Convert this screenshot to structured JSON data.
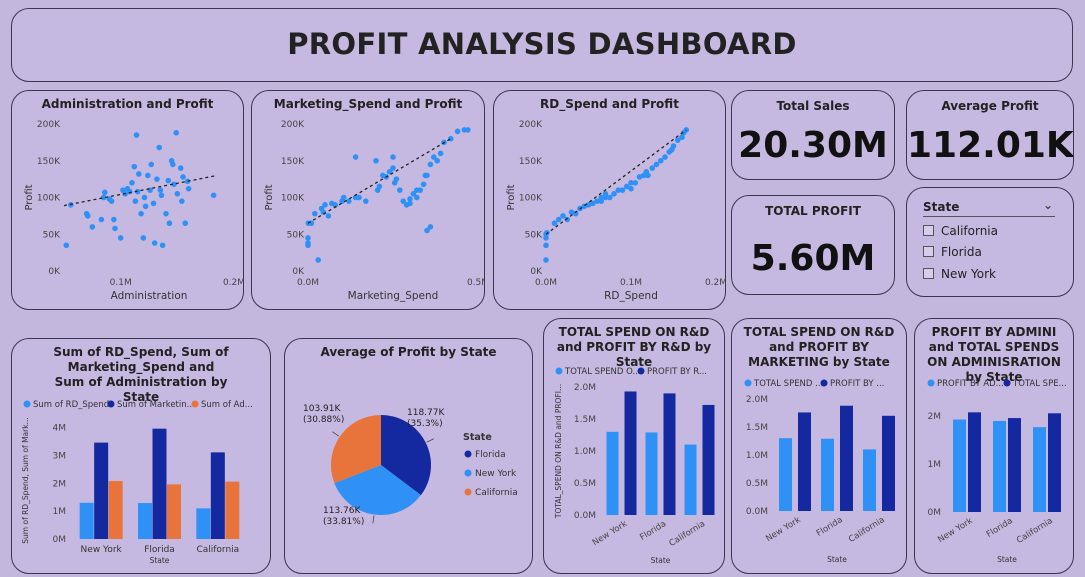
{
  "header": {
    "title": "PROFIT ANALYSIS DASHBOARD"
  },
  "kpis": {
    "total_sales": {
      "label": "Total Sales",
      "value": "20.30M"
    },
    "average_profit": {
      "label": "Average Profit",
      "value": "112.01K"
    },
    "total_profit": {
      "label": "TOTAL PROFIT",
      "value": "5.60M"
    }
  },
  "slicer": {
    "title": "State",
    "options": [
      "California",
      "Florida",
      "New York"
    ]
  },
  "colors": {
    "light_blue": "#2f90f5",
    "dark_blue": "#1428a0",
    "orange": "#e8743b",
    "card_bg": "#c6b9e1"
  },
  "chart_data": [
    {
      "id": "admin_profit",
      "type": "scatter",
      "title": "Administration and Profit",
      "xlabel": "Administration",
      "ylabel": "Profit",
      "xlim": [
        0.05,
        0.2
      ],
      "ylim": [
        0,
        200
      ],
      "xticks": [
        "0.1M",
        "0.2M"
      ],
      "yticks": [
        "0K",
        "50K",
        "100K",
        "150K",
        "200K"
      ],
      "trend": [
        [
          0.05,
          89
        ],
        [
          0.185,
          130
        ]
      ],
      "points": [
        [
          0.052,
          35
        ],
        [
          0.056,
          90
        ],
        [
          0.07,
          78
        ],
        [
          0.071,
          75
        ],
        [
          0.075,
          60
        ],
        [
          0.083,
          70
        ],
        [
          0.085,
          100
        ],
        [
          0.086,
          107
        ],
        [
          0.09,
          98
        ],
        [
          0.092,
          95
        ],
        [
          0.094,
          70
        ],
        [
          0.095,
          58
        ],
        [
          0.1,
          45
        ],
        [
          0.102,
          110
        ],
        [
          0.104,
          105
        ],
        [
          0.106,
          112
        ],
        [
          0.108,
          108
        ],
        [
          0.11,
          120
        ],
        [
          0.112,
          142
        ],
        [
          0.113,
          95
        ],
        [
          0.114,
          185
        ],
        [
          0.115,
          108
        ],
        [
          0.116,
          132
        ],
        [
          0.118,
          78
        ],
        [
          0.12,
          45
        ],
        [
          0.121,
          100
        ],
        [
          0.122,
          88
        ],
        [
          0.124,
          130
        ],
        [
          0.126,
          110
        ],
        [
          0.127,
          145
        ],
        [
          0.129,
          92
        ],
        [
          0.13,
          38
        ],
        [
          0.132,
          125
        ],
        [
          0.134,
          168
        ],
        [
          0.135,
          110
        ],
        [
          0.136,
          103
        ],
        [
          0.137,
          35
        ],
        [
          0.14,
          78
        ],
        [
          0.142,
          123
        ],
        [
          0.143,
          65
        ],
        [
          0.145,
          150
        ],
        [
          0.146,
          145
        ],
        [
          0.147,
          118
        ],
        [
          0.149,
          188
        ],
        [
          0.15,
          105
        ],
        [
          0.153,
          140
        ],
        [
          0.154,
          95
        ],
        [
          0.155,
          128
        ],
        [
          0.157,
          65
        ],
        [
          0.159,
          122
        ],
        [
          0.16,
          112
        ],
        [
          0.182,
          103
        ]
      ]
    },
    {
      "id": "marketing_profit",
      "type": "scatter",
      "title": "Marketing_Spend and Profit",
      "xlabel": "Marketing_Spend",
      "ylabel": "Profit",
      "xlim": [
        0,
        0.5
      ],
      "ylim": [
        0,
        200
      ],
      "xticks": [
        "0.0M",
        "0.5M"
      ],
      "yticks": [
        "0K",
        "50K",
        "100K",
        "150K",
        "200K"
      ],
      "trend": [
        [
          0,
          65
        ],
        [
          0.42,
          180
        ]
      ],
      "points": [
        [
          0,
          45
        ],
        [
          0,
          38
        ],
        [
          0,
          35
        ],
        [
          0.001,
          65
        ],
        [
          0.01,
          65
        ],
        [
          0.02,
          78
        ],
        [
          0.03,
          15
        ],
        [
          0.04,
          85
        ],
        [
          0.045,
          80
        ],
        [
          0.05,
          90
        ],
        [
          0.06,
          75
        ],
        [
          0.07,
          92
        ],
        [
          0.08,
          90
        ],
        [
          0.1,
          95
        ],
        [
          0.105,
          100
        ],
        [
          0.12,
          95
        ],
        [
          0.14,
          100
        ],
        [
          0.14,
          155
        ],
        [
          0.15,
          100
        ],
        [
          0.17,
          95
        ],
        [
          0.2,
          150
        ],
        [
          0.205,
          110
        ],
        [
          0.21,
          115
        ],
        [
          0.22,
          130
        ],
        [
          0.23,
          128
        ],
        [
          0.24,
          135
        ],
        [
          0.25,
          140
        ],
        [
          0.25,
          155
        ],
        [
          0.255,
          120
        ],
        [
          0.26,
          125
        ],
        [
          0.27,
          110
        ],
        [
          0.28,
          95
        ],
        [
          0.29,
          90
        ],
        [
          0.3,
          98
        ],
        [
          0.3,
          92
        ],
        [
          0.31,
          105
        ],
        [
          0.32,
          110
        ],
        [
          0.32,
          100
        ],
        [
          0.33,
          110
        ],
        [
          0.34,
          118
        ],
        [
          0.345,
          130
        ],
        [
          0.35,
          130
        ],
        [
          0.35,
          55
        ],
        [
          0.36,
          60
        ],
        [
          0.36,
          145
        ],
        [
          0.37,
          155
        ],
        [
          0.38,
          150
        ],
        [
          0.39,
          160
        ],
        [
          0.4,
          175
        ],
        [
          0.42,
          180
        ],
        [
          0.44,
          190
        ],
        [
          0.46,
          192
        ],
        [
          0.47,
          192
        ]
      ]
    },
    {
      "id": "rd_profit",
      "type": "scatter",
      "title": "RD_Spend and Profit",
      "xlabel": "RD_Spend",
      "ylabel": "Profit",
      "xlim": [
        0,
        0.2
      ],
      "ylim": [
        0,
        200
      ],
      "xticks": [
        "0.0M",
        "0.1M",
        "0.2M"
      ],
      "yticks": [
        "0K",
        "50K",
        "100K",
        "150K",
        "200K"
      ],
      "trend": [
        [
          0,
          50
        ],
        [
          0.165,
          192
        ]
      ],
      "points": [
        [
          0,
          50
        ],
        [
          0,
          45
        ],
        [
          0,
          35
        ],
        [
          0,
          15
        ],
        [
          0.001,
          52
        ],
        [
          0.01,
          65
        ],
        [
          0.015,
          70
        ],
        [
          0.02,
          75
        ],
        [
          0.025,
          70
        ],
        [
          0.03,
          80
        ],
        [
          0.035,
          78
        ],
        [
          0.04,
          85
        ],
        [
          0.045,
          88
        ],
        [
          0.05,
          90
        ],
        [
          0.055,
          92
        ],
        [
          0.06,
          95
        ],
        [
          0.065,
          100
        ],
        [
          0.065,
          95
        ],
        [
          0.07,
          100
        ],
        [
          0.07,
          105
        ],
        [
          0.075,
          100
        ],
        [
          0.08,
          105
        ],
        [
          0.085,
          110
        ],
        [
          0.09,
          110
        ],
        [
          0.095,
          115
        ],
        [
          0.1,
          112
        ],
        [
          0.1,
          120
        ],
        [
          0.105,
          120
        ],
        [
          0.11,
          128
        ],
        [
          0.115,
          130
        ],
        [
          0.118,
          135
        ],
        [
          0.12,
          130
        ],
        [
          0.125,
          140
        ],
        [
          0.13,
          145
        ],
        [
          0.135,
          150
        ],
        [
          0.14,
          155
        ],
        [
          0.145,
          162
        ],
        [
          0.148,
          165
        ],
        [
          0.15,
          170
        ],
        [
          0.155,
          178
        ],
        [
          0.16,
          182
        ],
        [
          0.162,
          188
        ],
        [
          0.165,
          192
        ]
      ]
    },
    {
      "id": "sum_by_state",
      "type": "bar",
      "title": "Sum of RD_Spend, Sum of Marketing_Spend and Sum of Administration by State",
      "xlabel": "State",
      "ylabel": "Sum of RD_Spend, Sum of Mark...",
      "categories": [
        "New York",
        "Florida",
        "California"
      ],
      "yticks": [
        "0M",
        "1M",
        "2M",
        "3M",
        "4M"
      ],
      "ylim": [
        0,
        4.2
      ],
      "series": [
        {
          "name": "Sum of RD_Spend",
          "legend": "Sum of RD_Spend",
          "color": "#2f90f5",
          "values": [
            1.3,
            1.29,
            1.1
          ]
        },
        {
          "name": "Sum of Marketing_Spend",
          "legend": "Sum of Marketin...",
          "color": "#1428a0",
          "values": [
            3.46,
            3.96,
            3.11
          ]
        },
        {
          "name": "Sum of Administration",
          "legend": "Sum of Ad...",
          "color": "#e8743b",
          "values": [
            2.08,
            1.96,
            2.06
          ]
        }
      ]
    },
    {
      "id": "avg_profit_state",
      "type": "pie",
      "title": "Average of Profit by State",
      "legend_title": "State",
      "slices": [
        {
          "name": "Florida",
          "value": 118.77,
          "label": "118.77K",
          "pct": "(35.3%)",
          "color": "#1428a0"
        },
        {
          "name": "New York",
          "value": 113.76,
          "label": "113.76K",
          "pct": "(33.81%)",
          "color": "#2f90f5"
        },
        {
          "name": "California",
          "value": 103.91,
          "label": "103.91K",
          "pct": "(30.88%)",
          "color": "#e8743b"
        }
      ]
    },
    {
      "id": "rd_spend_profit",
      "type": "bar",
      "title": "TOTAL SPEND ON R&D and PROFIT BY R&D by State",
      "xlabel": "State",
      "ylabel": "TOTAL_SPEND ON R&D and PROFI...",
      "categories": [
        "New York",
        "Florida",
        "California"
      ],
      "yticks": [
        "0.0M",
        "0.5M",
        "1.0M",
        "1.5M",
        "2.0M"
      ],
      "ylim": [
        0,
        2.0
      ],
      "series": [
        {
          "name": "TOTAL SPEND ON R&D",
          "legend": "TOTAL SPEND O...",
          "color": "#2f90f5",
          "values": [
            1.3,
            1.29,
            1.1
          ]
        },
        {
          "name": "PROFIT BY R&D",
          "legend": "PROFIT BY R...",
          "color": "#1428a0",
          "values": [
            1.93,
            1.9,
            1.72
          ]
        }
      ]
    },
    {
      "id": "marketing_spend_profit",
      "type": "bar",
      "title": "TOTAL SPEND ON R&D and PROFIT BY MARKETING by State",
      "xlabel": "State",
      "ylabel": "",
      "categories": [
        "New York",
        "Florida",
        "California"
      ],
      "yticks": [
        "0.0M",
        "0.5M",
        "1.0M",
        "1.5M",
        "2.0M"
      ],
      "ylim": [
        0,
        2.0
      ],
      "series": [
        {
          "name": "TOTAL SPEND ON R&D",
          "legend": "TOTAL SPEND ...",
          "color": "#2f90f5",
          "values": [
            1.3,
            1.29,
            1.1
          ]
        },
        {
          "name": "PROFIT BY MARKETING",
          "legend": "PROFIT BY ...",
          "color": "#1428a0",
          "values": [
            1.76,
            1.88,
            1.7
          ]
        }
      ]
    },
    {
      "id": "admin_spend_profit",
      "type": "bar",
      "title": "PROFIT BY ADMINI and TOTAL SPENDS ON ADMINISRATION by State",
      "xlabel": "State",
      "ylabel": "",
      "categories": [
        "New York",
        "Florida",
        "California"
      ],
      "yticks": [
        "0M",
        "1M",
        "2M"
      ],
      "ylim": [
        0,
        2.4
      ],
      "series": [
        {
          "name": "PROFIT BY ADMINI",
          "legend": "PROFIT BY AD...",
          "color": "#2f90f5",
          "values": [
            1.93,
            1.9,
            1.77
          ]
        },
        {
          "name": "TOTAL SPENDS ON ADMINISRATION",
          "legend": "TOTAL SPE...",
          "color": "#1428a0",
          "values": [
            2.08,
            1.96,
            2.06
          ]
        }
      ]
    }
  ]
}
